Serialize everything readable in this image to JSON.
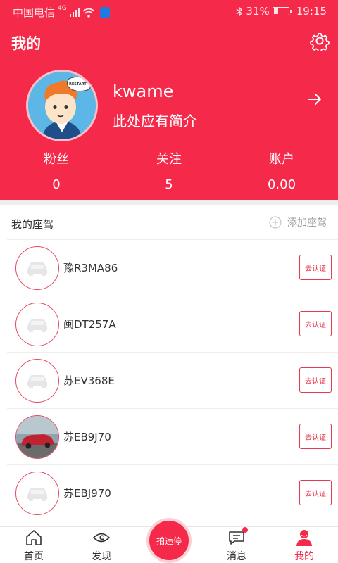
{
  "status_bar": {
    "carrier": "中国电信",
    "network": "4G",
    "battery_pct": "31%",
    "battery_level": 0.31,
    "time": "19:15"
  },
  "header": {
    "title": "我的",
    "username": "kwame",
    "bio": "此处应有简介",
    "avatar_badge_text": "RESTART",
    "stats": [
      {
        "label": "粉丝",
        "value": "0"
      },
      {
        "label": "关注",
        "value": "5"
      },
      {
        "label": "账户",
        "value": "0.00"
      }
    ]
  },
  "cars_section": {
    "title": "我的座驾",
    "add_label": "添加座驾",
    "verify_label": "去认证",
    "cars": [
      {
        "plate": "豫R3MA86",
        "has_photo": false
      },
      {
        "plate": "闽DT257A",
        "has_photo": false
      },
      {
        "plate": "苏EV368E",
        "has_photo": false
      },
      {
        "plate": "苏EB9J70",
        "has_photo": true
      },
      {
        "plate": "苏EBJ970",
        "has_photo": false
      }
    ]
  },
  "tabbar": {
    "tabs": [
      {
        "label": "首页",
        "icon": "home-icon",
        "active": false
      },
      {
        "label": "发现",
        "icon": "eye-icon",
        "active": false
      },
      {
        "label": "消息",
        "icon": "message-icon",
        "active": false,
        "badge": true
      },
      {
        "label": "我的",
        "icon": "profile-icon",
        "active": true
      }
    ],
    "center_label": "拍违停"
  },
  "colors": {
    "brand_red": "#f5294a",
    "divider": "#eeeeee"
  }
}
